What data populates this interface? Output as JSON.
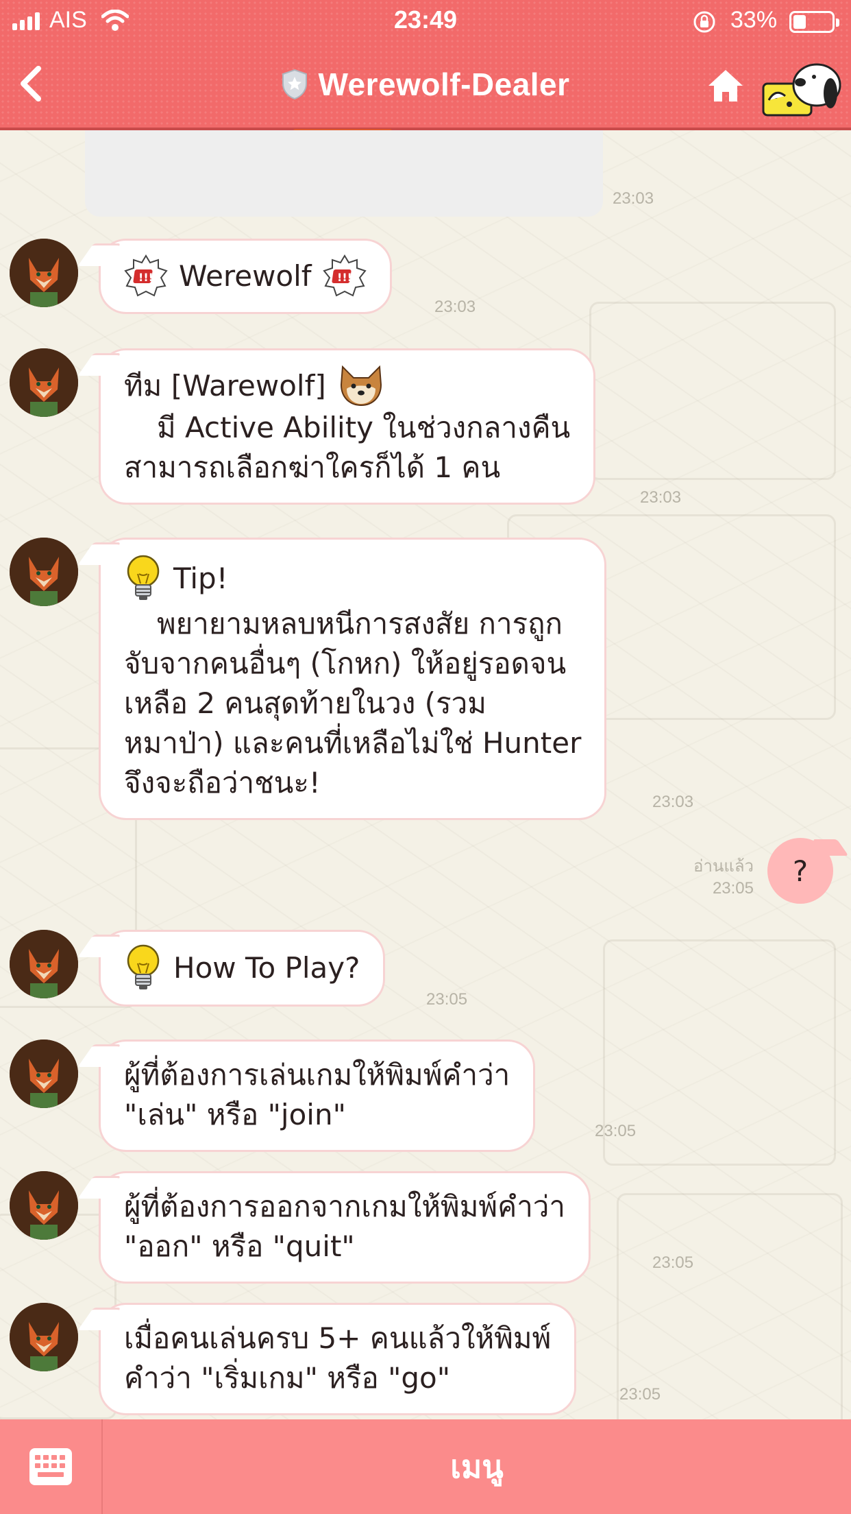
{
  "status_bar": {
    "carrier": "AIS",
    "time": "23:49",
    "battery_percent": "33%",
    "battery_level": 0.33
  },
  "header": {
    "title": "Werewolf-Dealer"
  },
  "messages": [
    {
      "id": "m0",
      "time": "23:03"
    },
    {
      "id": "m1",
      "title": "Werewolf",
      "time": "23:03"
    },
    {
      "id": "m2",
      "line1": "ทีม [Warewolf]",
      "line2": "มี Active Ability ในช่วงกลางคืน",
      "line3": "สามารถเลือกฆ่าใครก็ได้ 1 คน",
      "time": "23:03"
    },
    {
      "id": "m3",
      "title": "Tip!",
      "line1": "พยายามหลบหนีการสงสัย การถูก",
      "line2": "จับจากคนอื่นๆ (โกหก) ให้อยู่รอดจน",
      "line3": "เหลือ 2 คนสุดท้ายในวง (รวม",
      "line4": "หมาป่า) และคนที่เหลือไม่ใช่ Hunter",
      "line5": "จึงจะถือว่าชนะ!",
      "time": "23:03"
    },
    {
      "id": "m4",
      "title": "How To Play?",
      "time": "23:05"
    },
    {
      "id": "m5",
      "line1": "ผู้ที่ต้องการเล่นเกมให้พิมพ์คำว่า",
      "line2": "\"เล่น\" หรือ \"join\"",
      "time": "23:05"
    },
    {
      "id": "m6",
      "line1": "ผู้ที่ต้องการออกจากเกมให้พิมพ์คำว่า",
      "line2": "\"ออก\" หรือ \"quit\"",
      "time": "23:05"
    },
    {
      "id": "m7",
      "line1": "เมื่อคนเล่นครบ 5+ คนแล้วให้พิมพ์",
      "line2": "คำว่า \"เริ่มเกม\" หรือ \"go\"",
      "time": "23:05"
    }
  ],
  "outgoing": {
    "text": "?",
    "read_label": "อ่านแล้ว",
    "time": "23:05"
  },
  "bottom_bar": {
    "menu_label": "เมนู"
  },
  "colors": {
    "header": "#f26a6a",
    "bottom_bar": "#fb8b8b",
    "outgoing_bubble": "#ffb8b8",
    "bubble_border": "#f7d3d3"
  },
  "icons": [
    "signal-icon",
    "wifi-icon",
    "rotation-lock-icon",
    "battery-icon",
    "back-arrow-icon",
    "shield-icon",
    "home-icon",
    "snoopy-icon",
    "alert-badge-icon",
    "shiba-face-icon",
    "lightbulb-icon",
    "keyboard-icon"
  ]
}
